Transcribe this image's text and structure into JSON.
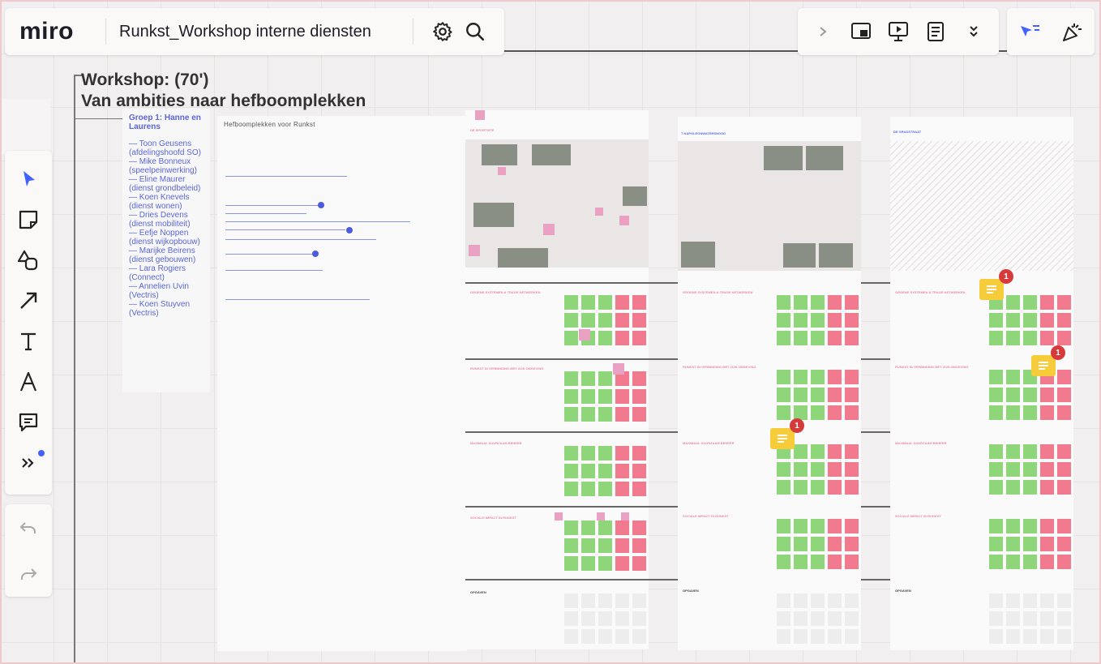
{
  "app": {
    "logo": "miro",
    "board_title": "Runkst_Workshop interne diensten"
  },
  "workshop": {
    "title_line1": "Workshop: (70')",
    "title_line2": "Van ambities naar hefboomplekken"
  },
  "group": {
    "title": "Groep 1: Hanne en Laurens",
    "members": [
      "— Toon Geusens (afdelingshoofd SO)",
      "— Mike Bonneux (speelpeinwerking)",
      "— Eline Maurer (dienst grondbeleid)",
      "— Koen Knevels (dienst wonen)",
      "— Dries Devens (dienst mobiliteit)",
      "— Eefje Noppen (dienst wijkopbouw)",
      "— Marijke Beirens (dienst gebouwen)",
      "— Lara Rogiers (Connect)",
      "— Annelien Uvin (Vectris)",
      "— Koen Stuyven (Vectris)"
    ]
  },
  "doc": {
    "title": "Hefboomplekken voor Runkst"
  },
  "panels": [
    {
      "header": "DE SPORTSITE",
      "sections": [
        "GROENE SYSTEMEN & TRAGE NETWERKEN",
        "RUNKST IN VERBINDING MET ZIJN OMGEVING",
        "MAXIMAAL DUURZAAM BEHEER",
        "SOCIALE IMPACT IN RUNKST"
      ],
      "footer": "OPGAVEN"
    },
    {
      "header": "T NAPOLEONWATERSNOOD",
      "sections": [
        "GROENE SYSTEMEN & TRAGE NETWERKEN",
        "RUNKST IN VERBINDING MET ZIJN OMGEVING",
        "MAXIMAAL DUURZAAM BEHEER",
        "SOCIALE IMPACT IN RUNKST"
      ],
      "footer": "OPGAVEN"
    },
    {
      "header": "DE GRASSTRAAT",
      "sections": [
        "GROENE SYSTEMEN & TRAGE NETWERKEN",
        "RUNKST IN VERBINDING MET ZIJN OMGEVING",
        "MAXIMAAL DUURZAAM BEHEER",
        "SOCIALE IMPACT IN RUNKST"
      ],
      "footer": "OPGAVEN"
    }
  ],
  "comments": [
    {
      "count": "1"
    },
    {
      "count": "1"
    },
    {
      "count": "1"
    }
  ],
  "colors": {
    "accent": "#4262ff",
    "sticky_green": "#8fd57a",
    "sticky_red": "#f27a8e",
    "comment_yellow": "#f6cc3a",
    "badge_red": "#d63b3b"
  },
  "icons": {
    "top": [
      "settings-icon",
      "search-icon"
    ],
    "top_right": [
      "chevron-right-icon",
      "share-screen-icon",
      "present-icon",
      "notes-icon",
      "chevron-double-down-icon"
    ],
    "top_right2": [
      "cursor-filter-icon",
      "celebrate-icon"
    ],
    "tools": [
      "select-icon",
      "sticky-note-icon",
      "shapes-icon",
      "arrow-icon",
      "text-icon",
      "pen-icon",
      "comment-icon",
      "more-tools-icon"
    ],
    "undo": [
      "undo-icon",
      "redo-icon"
    ]
  }
}
